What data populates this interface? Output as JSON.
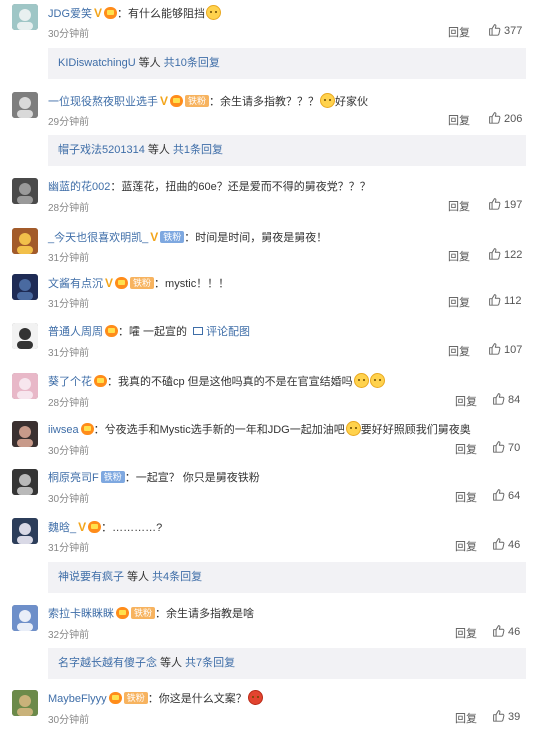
{
  "colors": {
    "link": "#3f6ea8",
    "muted": "#888888",
    "subbox": "#f2f2f5",
    "badge_v": "#f3a51b"
  },
  "reply_label": "回复",
  "comments": [
    {
      "user": "JDG爱笑",
      "v": true,
      "crown": true,
      "fan": "",
      "text": "有什么能够阻挡",
      "time": "30分钟前",
      "likes": "377",
      "emoji_after": 1
    },
    {
      "user": "一位现役熬夜职业选手",
      "v": true,
      "crown": true,
      "fan": "铁粉",
      "text": "余生请多指教？？？",
      "time": "29分钟前",
      "likes": "206",
      "emoji_after": 1,
      "text2": "好家伙"
    },
    {
      "user": "幽蓝的花002",
      "v": false,
      "crown": false,
      "fan": "",
      "text": "蓝莲花，扭曲的60e？还是爱而不得的舅夜党？？？",
      "time": "28分钟前",
      "likes": "197"
    },
    {
      "user": "_今天也很喜欢明凯_",
      "v": true,
      "crown": false,
      "fan": "铁粉",
      "text": "时间是时间，舅夜是舅夜！",
      "time": "31分钟前",
      "likes": "122"
    },
    {
      "user": "文酱有点沉",
      "v": true,
      "crown": true,
      "fan": "铁粉",
      "text": "mystic！！！",
      "time": "31分钟前",
      "likes": "112"
    },
    {
      "user": "普通人周周",
      "v": false,
      "crown": true,
      "fan": "",
      "text": "嚯 一起宣的",
      "time": "31分钟前",
      "likes": "107",
      "pic": "评论配图"
    },
    {
      "user": "葵了个花",
      "v": false,
      "crown": true,
      "fan": "",
      "text": "我真的不磕cp 但是这他吗真的不是在官宣结婚吗",
      "time": "28分钟前",
      "likes": "84",
      "emoji_after": 2
    },
    {
      "user": "iiwsea",
      "v": false,
      "crown": true,
      "fan": "",
      "text": "兮夜选手和Mystic选手新的一年和JDG一起加油吧",
      "time": "30分钟前",
      "likes": "70",
      "emoji_after": 1,
      "text2": "要好好照顾我们舅夜奥"
    },
    {
      "user": "桐原亮司F",
      "v": false,
      "crown": false,
      "fan": "铁粉",
      "text": "一起宣？ 你只是舅夜铁粉",
      "time": "30分钟前",
      "likes": "64"
    },
    {
      "user": "魏晗_",
      "v": true,
      "crown": true,
      "fan": "",
      "text": "…………?",
      "time": "31分钟前",
      "likes": "46"
    },
    {
      "user": "索拉卡眯眯眯",
      "v": false,
      "crown": true,
      "fan": "铁粉",
      "text": "余生请多指教是啥",
      "time": "32分钟前",
      "likes": "46"
    },
    {
      "user": "MaybeFlyyy",
      "v": false,
      "crown": true,
      "fan": "铁粉",
      "text": "你这是什么文案？",
      "time": "30分钟前",
      "likes": "39",
      "emoji_red": true
    }
  ],
  "reply_boxes": [
    {
      "user": "KIDiswatchingU",
      "etc": "等人",
      "count": "共10条回复"
    },
    {
      "user": "帽子戏法5201314",
      "etc": "等人",
      "count": "共1条回复"
    },
    {
      "user": "神说要有疯子",
      "etc": "等人",
      "count": "共4条回复"
    },
    {
      "user": "名字越长越有傻子念",
      "etc": "等人",
      "count": "共7条回复"
    }
  ]
}
